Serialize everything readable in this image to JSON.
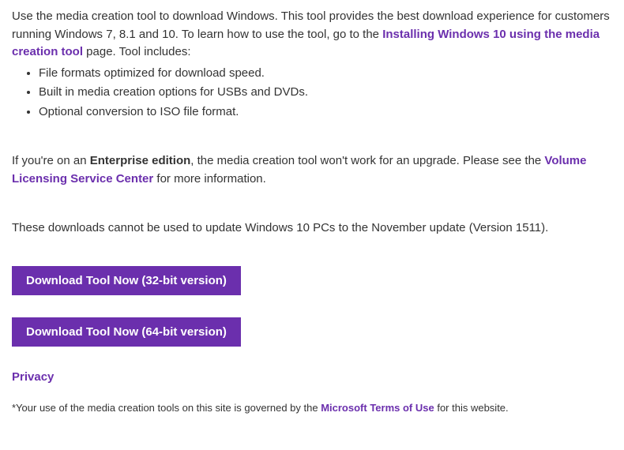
{
  "intro": {
    "text_before_link": "Use the media creation tool to download Windows. This tool provides the best download experience for customers running Windows 7, 8.1 and 10. To learn how to use the tool, go to the ",
    "link_text": "Installing Windows 10 using the media creation tool",
    "text_after_link": " page. Tool includes:"
  },
  "bullets": [
    "File formats optimized for download speed.",
    "Built in media creation options for USBs and DVDs.",
    "Optional conversion to ISO file format."
  ],
  "enterprise": {
    "before_bold": "If you're on an ",
    "bold_text": "Enterprise edition",
    "after_bold_before_link": ", the media creation tool won't work for an upgrade. Please see the ",
    "link_text": "Volume Licensing Service Center",
    "after_link": " for more information."
  },
  "note": "These downloads cannot be used to update Windows 10 PCs to the November update (Version 1511).",
  "buttons": {
    "download_32": "Download Tool Now (32-bit version)",
    "download_64": "Download Tool Now (64-bit version)"
  },
  "privacy_label": "Privacy",
  "footnote": {
    "before_link": "*Your use of the media creation tools on this site is governed by the ",
    "link_text": "Microsoft Terms of Use",
    "after_link": " for this website."
  }
}
